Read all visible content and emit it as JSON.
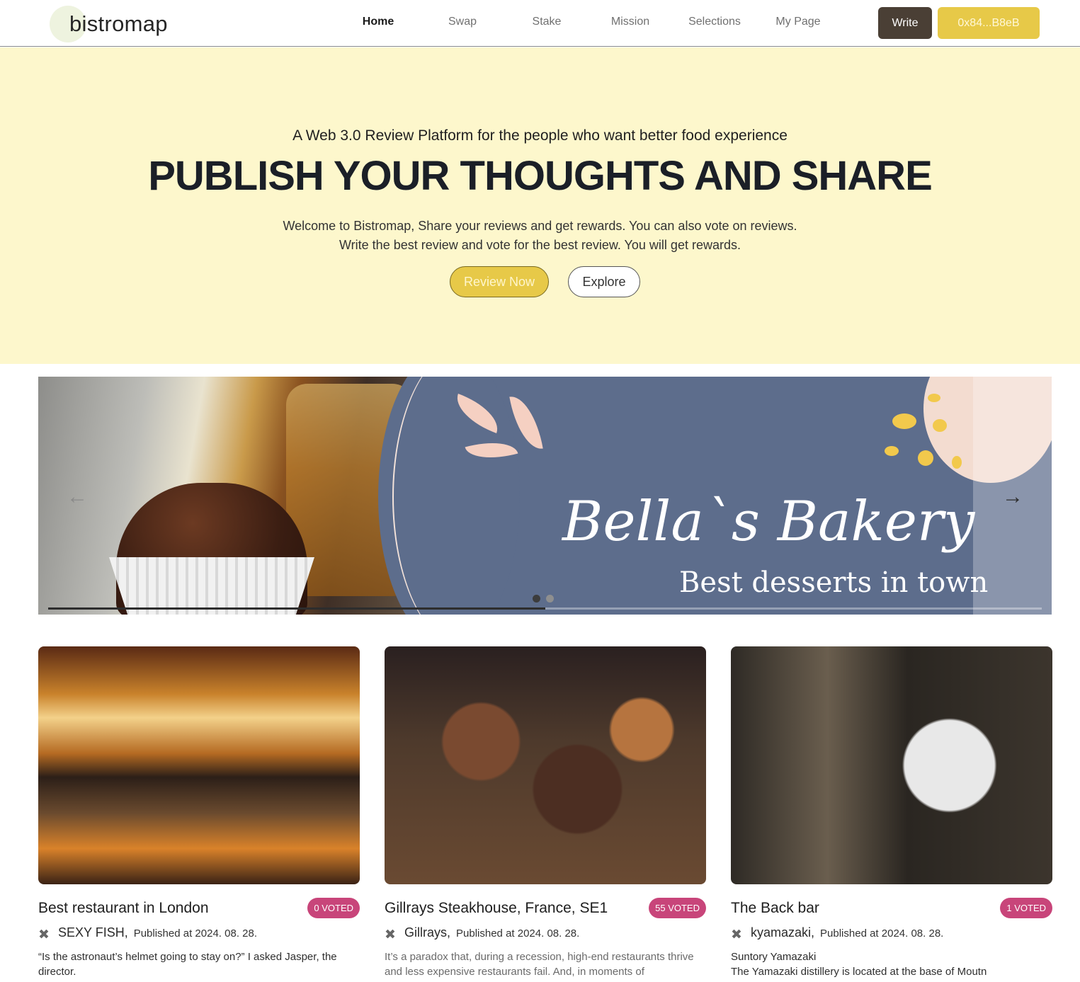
{
  "header": {
    "logo": "bistromap",
    "nav": [
      "Home",
      "Swap",
      "Stake",
      "Mission",
      "Selections",
      "My Page"
    ],
    "active_nav": "Home",
    "write_label": "Write",
    "wallet_label": "0x84...B8eB"
  },
  "hero": {
    "kicker": "A Web 3.0 Review Platform for the people who want better food experience",
    "title": "PUBLISH YOUR THOUGHTS AND SHARE",
    "desc_line1": "Welcome to Bistromap, Share your reviews and get rewards. You can also vote on reviews.",
    "desc_line2": "Write the best review and vote for the best review. You will get rewards.",
    "primary_button": "Review Now",
    "secondary_button": "Explore"
  },
  "banner": {
    "title": "Bella`s Bakery",
    "subtitle": "Best desserts in town",
    "prev_icon": "arrow-left-icon",
    "next_icon": "arrow-right-icon",
    "slide_count": 2,
    "active_slide": 1,
    "progress": 0.5
  },
  "cards": [
    {
      "title": "Best restaurant in London",
      "votes": "0 VOTED",
      "author": "SEXY FISH,",
      "published": "Published at 2024. 08. 28.",
      "subtitle": "",
      "excerpt": "“Is the astronaut’s helmet going to stay on?” I asked Jasper, the director."
    },
    {
      "title": "Gillrays Steakhouse, France, SE1",
      "votes": "55 VOTED",
      "author": "Gillrays,",
      "published": "Published at 2024. 08. 28.",
      "subtitle": "",
      "excerpt": "It’s a paradox that, during a recession, high-end restaurants thrive and less expensive restaurants fail. And, in moments of"
    },
    {
      "title": "The Back bar",
      "votes": "1 VOTED",
      "author": "kyamazaki,",
      "published": "Published at 2024. 08. 28.",
      "subtitle": "Suntory Yamazaki",
      "excerpt": "The Yamazaki distillery is located at the base of Moutn"
    }
  ],
  "colors": {
    "hero_bg": "#fdf7cc",
    "accent_yellow": "#e7c948",
    "write_brown": "#4a3f35",
    "vote_pink": "#c8457a",
    "banner_blue": "#5d6d8c"
  },
  "icons": {
    "cutlery": "cutlery-icon"
  }
}
